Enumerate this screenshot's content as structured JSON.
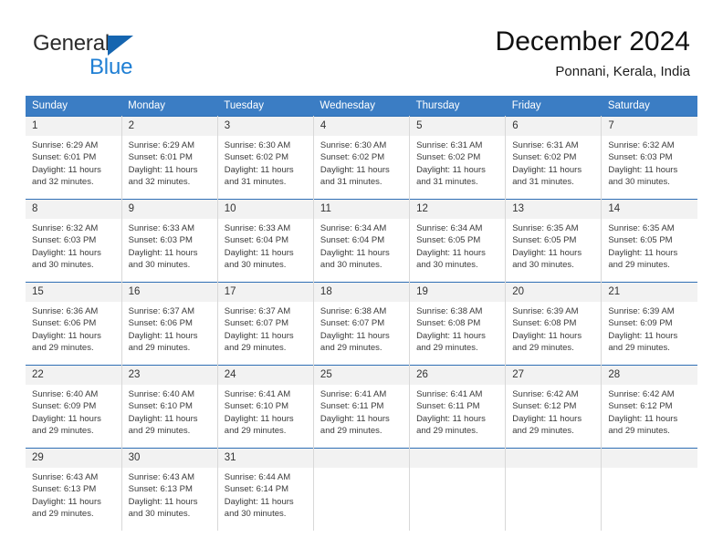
{
  "brand": {
    "name_top": "General",
    "name_bottom": "Blue",
    "triangle_color": "#1565b0",
    "blue_color": "#1f7fd4"
  },
  "header": {
    "title": "December 2024",
    "subtitle": "Ponnani, Kerala, India"
  },
  "theme": {
    "header_blue": "#3b7dc4",
    "row_divider_blue": "#2f6fb5",
    "daynum_band": "#f2f2f2",
    "cell_border": "#d8d8d8"
  },
  "calendar": {
    "weekday_headers": [
      "Sunday",
      "Monday",
      "Tuesday",
      "Wednesday",
      "Thursday",
      "Friday",
      "Saturday"
    ],
    "weeks": [
      [
        {
          "day": "1",
          "sunrise": "Sunrise: 6:29 AM",
          "sunset": "Sunset: 6:01 PM",
          "daylight1": "Daylight: 11 hours",
          "daylight2": "and 32 minutes."
        },
        {
          "day": "2",
          "sunrise": "Sunrise: 6:29 AM",
          "sunset": "Sunset: 6:01 PM",
          "daylight1": "Daylight: 11 hours",
          "daylight2": "and 32 minutes."
        },
        {
          "day": "3",
          "sunrise": "Sunrise: 6:30 AM",
          "sunset": "Sunset: 6:02 PM",
          "daylight1": "Daylight: 11 hours",
          "daylight2": "and 31 minutes."
        },
        {
          "day": "4",
          "sunrise": "Sunrise: 6:30 AM",
          "sunset": "Sunset: 6:02 PM",
          "daylight1": "Daylight: 11 hours",
          "daylight2": "and 31 minutes."
        },
        {
          "day": "5",
          "sunrise": "Sunrise: 6:31 AM",
          "sunset": "Sunset: 6:02 PM",
          "daylight1": "Daylight: 11 hours",
          "daylight2": "and 31 minutes."
        },
        {
          "day": "6",
          "sunrise": "Sunrise: 6:31 AM",
          "sunset": "Sunset: 6:02 PM",
          "daylight1": "Daylight: 11 hours",
          "daylight2": "and 31 minutes."
        },
        {
          "day": "7",
          "sunrise": "Sunrise: 6:32 AM",
          "sunset": "Sunset: 6:03 PM",
          "daylight1": "Daylight: 11 hours",
          "daylight2": "and 30 minutes."
        }
      ],
      [
        {
          "day": "8",
          "sunrise": "Sunrise: 6:32 AM",
          "sunset": "Sunset: 6:03 PM",
          "daylight1": "Daylight: 11 hours",
          "daylight2": "and 30 minutes."
        },
        {
          "day": "9",
          "sunrise": "Sunrise: 6:33 AM",
          "sunset": "Sunset: 6:03 PM",
          "daylight1": "Daylight: 11 hours",
          "daylight2": "and 30 minutes."
        },
        {
          "day": "10",
          "sunrise": "Sunrise: 6:33 AM",
          "sunset": "Sunset: 6:04 PM",
          "daylight1": "Daylight: 11 hours",
          "daylight2": "and 30 minutes."
        },
        {
          "day": "11",
          "sunrise": "Sunrise: 6:34 AM",
          "sunset": "Sunset: 6:04 PM",
          "daylight1": "Daylight: 11 hours",
          "daylight2": "and 30 minutes."
        },
        {
          "day": "12",
          "sunrise": "Sunrise: 6:34 AM",
          "sunset": "Sunset: 6:05 PM",
          "daylight1": "Daylight: 11 hours",
          "daylight2": "and 30 minutes."
        },
        {
          "day": "13",
          "sunrise": "Sunrise: 6:35 AM",
          "sunset": "Sunset: 6:05 PM",
          "daylight1": "Daylight: 11 hours",
          "daylight2": "and 30 minutes."
        },
        {
          "day": "14",
          "sunrise": "Sunrise: 6:35 AM",
          "sunset": "Sunset: 6:05 PM",
          "daylight1": "Daylight: 11 hours",
          "daylight2": "and 29 minutes."
        }
      ],
      [
        {
          "day": "15",
          "sunrise": "Sunrise: 6:36 AM",
          "sunset": "Sunset: 6:06 PM",
          "daylight1": "Daylight: 11 hours",
          "daylight2": "and 29 minutes."
        },
        {
          "day": "16",
          "sunrise": "Sunrise: 6:37 AM",
          "sunset": "Sunset: 6:06 PM",
          "daylight1": "Daylight: 11 hours",
          "daylight2": "and 29 minutes."
        },
        {
          "day": "17",
          "sunrise": "Sunrise: 6:37 AM",
          "sunset": "Sunset: 6:07 PM",
          "daylight1": "Daylight: 11 hours",
          "daylight2": "and 29 minutes."
        },
        {
          "day": "18",
          "sunrise": "Sunrise: 6:38 AM",
          "sunset": "Sunset: 6:07 PM",
          "daylight1": "Daylight: 11 hours",
          "daylight2": "and 29 minutes."
        },
        {
          "day": "19",
          "sunrise": "Sunrise: 6:38 AM",
          "sunset": "Sunset: 6:08 PM",
          "daylight1": "Daylight: 11 hours",
          "daylight2": "and 29 minutes."
        },
        {
          "day": "20",
          "sunrise": "Sunrise: 6:39 AM",
          "sunset": "Sunset: 6:08 PM",
          "daylight1": "Daylight: 11 hours",
          "daylight2": "and 29 minutes."
        },
        {
          "day": "21",
          "sunrise": "Sunrise: 6:39 AM",
          "sunset": "Sunset: 6:09 PM",
          "daylight1": "Daylight: 11 hours",
          "daylight2": "and 29 minutes."
        }
      ],
      [
        {
          "day": "22",
          "sunrise": "Sunrise: 6:40 AM",
          "sunset": "Sunset: 6:09 PM",
          "daylight1": "Daylight: 11 hours",
          "daylight2": "and 29 minutes."
        },
        {
          "day": "23",
          "sunrise": "Sunrise: 6:40 AM",
          "sunset": "Sunset: 6:10 PM",
          "daylight1": "Daylight: 11 hours",
          "daylight2": "and 29 minutes."
        },
        {
          "day": "24",
          "sunrise": "Sunrise: 6:41 AM",
          "sunset": "Sunset: 6:10 PM",
          "daylight1": "Daylight: 11 hours",
          "daylight2": "and 29 minutes."
        },
        {
          "day": "25",
          "sunrise": "Sunrise: 6:41 AM",
          "sunset": "Sunset: 6:11 PM",
          "daylight1": "Daylight: 11 hours",
          "daylight2": "and 29 minutes."
        },
        {
          "day": "26",
          "sunrise": "Sunrise: 6:41 AM",
          "sunset": "Sunset: 6:11 PM",
          "daylight1": "Daylight: 11 hours",
          "daylight2": "and 29 minutes."
        },
        {
          "day": "27",
          "sunrise": "Sunrise: 6:42 AM",
          "sunset": "Sunset: 6:12 PM",
          "daylight1": "Daylight: 11 hours",
          "daylight2": "and 29 minutes."
        },
        {
          "day": "28",
          "sunrise": "Sunrise: 6:42 AM",
          "sunset": "Sunset: 6:12 PM",
          "daylight1": "Daylight: 11 hours",
          "daylight2": "and 29 minutes."
        }
      ],
      [
        {
          "day": "29",
          "sunrise": "Sunrise: 6:43 AM",
          "sunset": "Sunset: 6:13 PM",
          "daylight1": "Daylight: 11 hours",
          "daylight2": "and 29 minutes."
        },
        {
          "day": "30",
          "sunrise": "Sunrise: 6:43 AM",
          "sunset": "Sunset: 6:13 PM",
          "daylight1": "Daylight: 11 hours",
          "daylight2": "and 30 minutes."
        },
        {
          "day": "31",
          "sunrise": "Sunrise: 6:44 AM",
          "sunset": "Sunset: 6:14 PM",
          "daylight1": "Daylight: 11 hours",
          "daylight2": "and 30 minutes."
        },
        {
          "day": "",
          "sunrise": "",
          "sunset": "",
          "daylight1": "",
          "daylight2": ""
        },
        {
          "day": "",
          "sunrise": "",
          "sunset": "",
          "daylight1": "",
          "daylight2": ""
        },
        {
          "day": "",
          "sunrise": "",
          "sunset": "",
          "daylight1": "",
          "daylight2": ""
        },
        {
          "day": "",
          "sunrise": "",
          "sunset": "",
          "daylight1": "",
          "daylight2": ""
        }
      ]
    ]
  }
}
